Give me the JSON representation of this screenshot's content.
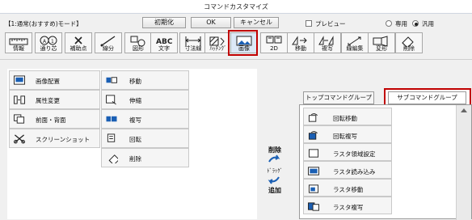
{
  "window": {
    "title": "コマンドカスタマイズ"
  },
  "header": {
    "mode_label": "【1:通常(おすすめ)モード】",
    "init_label": "初期化",
    "ok_label": "OK",
    "cancel_label": "キャンセル",
    "preview_label": "プレビュー",
    "radio_exclusive": "専用",
    "radio_general": "汎用",
    "radio_selected": "汎用"
  },
  "toolbar": [
    {
      "label": "情報",
      "icon": "ruler-icon"
    },
    {
      "label": "通り芯",
      "icon": "grid-axis-icon"
    },
    {
      "label": "補助点",
      "icon": "cross-point-icon"
    },
    {
      "label": "線分",
      "icon": "line-icon"
    },
    {
      "label": "図形",
      "icon": "shape-icon"
    },
    {
      "label": "文字",
      "icon": "text-abc-icon"
    },
    {
      "label": "寸法線",
      "icon": "dimension-icon"
    },
    {
      "label": "ﾊｯﾁﾝｸﾞ",
      "icon": "hatching-icon"
    },
    {
      "label": "画像",
      "icon": "image-icon",
      "highlighted": true
    },
    {
      "label": "2D",
      "icon": "2d-icon"
    },
    {
      "label": "移動",
      "icon": "move-icon"
    },
    {
      "label": "複写",
      "icon": "copy-icon"
    },
    {
      "label": "線編集",
      "icon": "line-edit-icon"
    },
    {
      "label": "変形",
      "icon": "transform-icon"
    },
    {
      "label": "削除",
      "icon": "eraser-icon"
    }
  ],
  "left_list": {
    "col1": [
      {
        "label": "画像配置",
        "icon": "image-place-icon"
      },
      {
        "label": "属性変更",
        "icon": "attribute-change-icon"
      },
      {
        "label": "前面・背面",
        "icon": "front-back-icon"
      },
      {
        "label": "スクリーンショット",
        "icon": "screenshot-icon"
      }
    ],
    "col2": [
      {
        "label": "移動",
        "icon": "image-move-icon"
      },
      {
        "label": "伸縮",
        "icon": "stretch-icon"
      },
      {
        "label": "複写",
        "icon": "image-copy-icon"
      },
      {
        "label": "回転",
        "icon": "rotate-icon"
      },
      {
        "label": "削除",
        "icon": "eraser-icon"
      }
    ]
  },
  "drag_hint": {
    "delete": "削除",
    "drag": "ﾄﾞﾗｯｸﾞ",
    "add": "追加"
  },
  "right_panel": {
    "tab_top_group": "トップコマンドグループ",
    "tab_sub_group": "サブコマンドグループ",
    "items": [
      {
        "label": "回転移動",
        "icon": "rotate-move-icon"
      },
      {
        "label": "回転複写",
        "icon": "rotate-copy-icon"
      },
      {
        "label": "ラスタ領域設定",
        "icon": "raster-area-icon"
      },
      {
        "label": "ラスタ読み込み",
        "icon": "raster-load-icon"
      },
      {
        "label": "ラスタ移動",
        "icon": "raster-move-icon"
      },
      {
        "label": "ラスタ複写",
        "icon": "raster-copy-icon"
      }
    ]
  },
  "colors": {
    "highlight": "#c00000",
    "icon_blue": "#1a5fb4"
  }
}
